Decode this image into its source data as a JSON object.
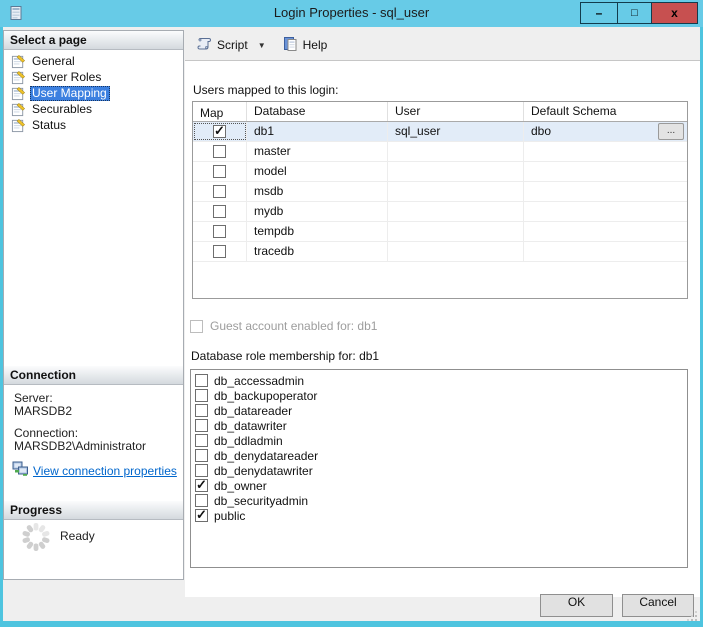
{
  "window": {
    "title": "Login Properties - sql_user",
    "controls": {
      "minimize": "–",
      "maximize": "□",
      "close": "x"
    }
  },
  "sidebar": {
    "select_page": {
      "header": "Select a page",
      "items": [
        {
          "label": "General",
          "selected": false
        },
        {
          "label": "Server Roles",
          "selected": false
        },
        {
          "label": "User Mapping",
          "selected": true
        },
        {
          "label": "Securables",
          "selected": false
        },
        {
          "label": "Status",
          "selected": false
        }
      ]
    },
    "connection": {
      "header": "Connection",
      "server_label": "Server:",
      "server_value": "MARSDB2",
      "connection_label": "Connection:",
      "connection_value": "MARSDB2\\Administrator",
      "link_label": "View connection properties"
    },
    "progress": {
      "header": "Progress",
      "status": "Ready"
    }
  },
  "toolbar": {
    "script_label": "Script",
    "help_label": "Help",
    "dropdown_glyph": "▼"
  },
  "main": {
    "users_label": "Users mapped to this login:",
    "users_table": {
      "columns": [
        "Map",
        "Database",
        "User",
        "Default Schema"
      ],
      "browse_label": "...",
      "rows": [
        {
          "map": true,
          "database": "db1",
          "user": "sql_user",
          "default_schema": "dbo",
          "selected": true,
          "has_browse": true
        },
        {
          "map": false,
          "database": "master",
          "user": "",
          "default_schema": "",
          "selected": false,
          "has_browse": false
        },
        {
          "map": false,
          "database": "model",
          "user": "",
          "default_schema": "",
          "selected": false,
          "has_browse": false
        },
        {
          "map": false,
          "database": "msdb",
          "user": "",
          "default_schema": "",
          "selected": false,
          "has_browse": false
        },
        {
          "map": false,
          "database": "mydb",
          "user": "",
          "default_schema": "",
          "selected": false,
          "has_browse": false
        },
        {
          "map": false,
          "database": "tempdb",
          "user": "",
          "default_schema": "",
          "selected": false,
          "has_browse": false
        },
        {
          "map": false,
          "database": "tracedb",
          "user": "",
          "default_schema": "",
          "selected": false,
          "has_browse": false
        }
      ]
    },
    "guest": {
      "label": "Guest account enabled for: db1",
      "checked": false,
      "enabled": false
    },
    "roles": {
      "label": "Database role membership for: db1",
      "items": [
        {
          "label": "db_accessadmin",
          "checked": false
        },
        {
          "label": "db_backupoperator",
          "checked": false
        },
        {
          "label": "db_datareader",
          "checked": false
        },
        {
          "label": "db_datawriter",
          "checked": false
        },
        {
          "label": "db_ddladmin",
          "checked": false
        },
        {
          "label": "db_denydatareader",
          "checked": false
        },
        {
          "label": "db_denydatawriter",
          "checked": false
        },
        {
          "label": "db_owner",
          "checked": true
        },
        {
          "label": "db_securityadmin",
          "checked": false
        },
        {
          "label": "public",
          "checked": true
        }
      ]
    }
  },
  "footer": {
    "ok_label": "OK",
    "cancel_label": "Cancel"
  },
  "colors": {
    "titlebar": "#67cbe7",
    "window_border": "#4ec4df",
    "close_button": "#c75050",
    "selection": "#3c80e0",
    "selected_row": "#e2ecf8",
    "link": "#0066cc"
  }
}
